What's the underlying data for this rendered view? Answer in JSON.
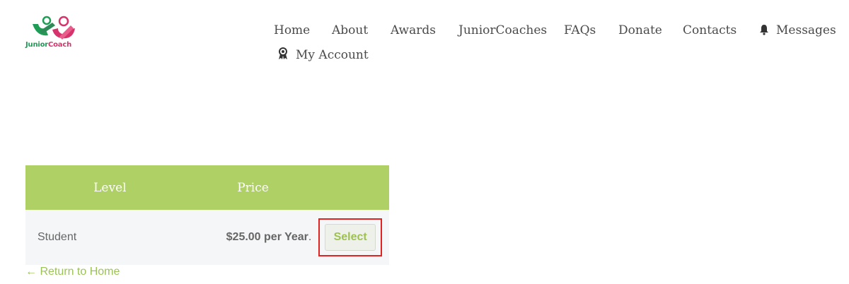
{
  "logo": {
    "part1": "Junior",
    "part2": "Coach"
  },
  "nav": {
    "home": "Home",
    "about": "About",
    "awards": "Awards",
    "juniorcoaches": "JuniorCoaches",
    "faqs": "FAQs",
    "donate": "Donate",
    "contacts": "Contacts",
    "messages": "Messages",
    "my_account": "My Account",
    "messages_icon": "bell-icon",
    "my_account_icon": "award-ribbon-icon"
  },
  "levels_table": {
    "headers": {
      "level": "Level",
      "price": "Price"
    },
    "rows": [
      {
        "level": "Student",
        "price_amount": "$25.00 per Year",
        "price_suffix": ".",
        "action": "Select"
      }
    ]
  },
  "footer_link": "← Return to Home",
  "colors": {
    "header_bg": "#aed065",
    "accent_green": "#9cc357",
    "highlight_red": "#e02424",
    "row_bg": "#f5f6f7"
  }
}
